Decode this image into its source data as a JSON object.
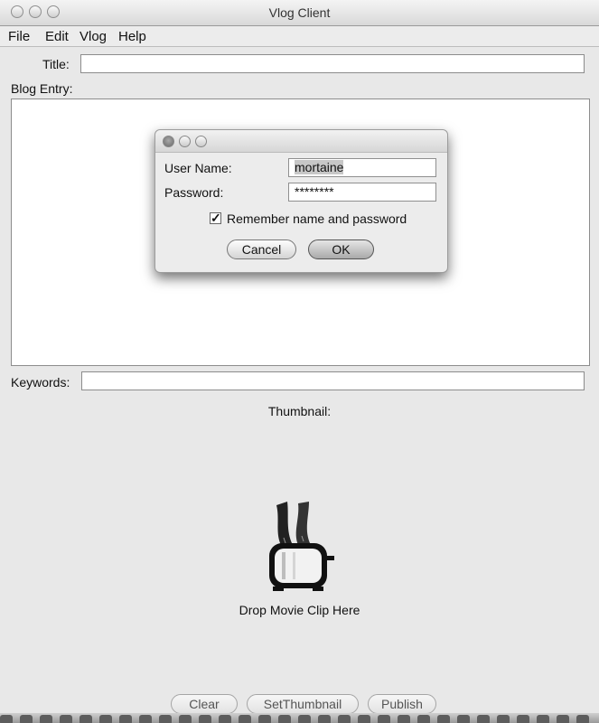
{
  "window": {
    "title": "Vlog Client"
  },
  "menu": {
    "items": [
      "File",
      "Edit",
      "Vlog",
      "Help"
    ]
  },
  "form": {
    "title_label": "Title:",
    "title_value": "",
    "blog_entry_label": "Blog Entry:",
    "keywords_label": "Keywords:",
    "keywords_value": "",
    "thumbnail_label": "Thumbnail:",
    "drop_label": "Drop Movie Clip Here"
  },
  "dialog": {
    "user_name_label": "User Name:",
    "user_name_value": "mortaine",
    "password_label": "Password:",
    "password_value": "********",
    "remember_label": "Remember name and password",
    "remember_checked": true,
    "cancel_label": "Cancel",
    "ok_label": "OK"
  },
  "buttons": {
    "clear": "Clear",
    "set_thumbnail": "SetThumbnail",
    "publish": "Publish"
  },
  "icons": {
    "drop_target": "toaster-icon",
    "checkbox_mark": "✓"
  }
}
